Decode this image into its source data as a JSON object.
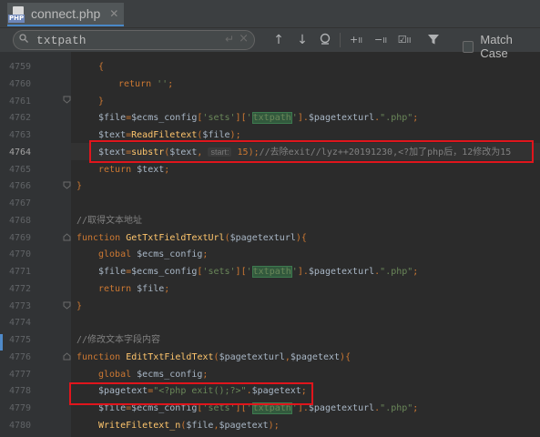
{
  "tab": {
    "title": "connect.php",
    "icon": "php-file-icon",
    "close": "✕"
  },
  "search": {
    "query": "txtpath",
    "match_case_label": "Match Case",
    "match_case_checked": false
  },
  "editor": {
    "lines": [
      {
        "n": "4759",
        "code": "{"
      },
      {
        "n": "4760",
        "code": "return '';"
      },
      {
        "n": "4761",
        "code": "}"
      },
      {
        "n": "4762",
        "code": "$file=$ecms_config['sets']['txtpath'].$pagetexturl.\".php\";"
      },
      {
        "n": "4763",
        "code": "$text=ReadFiletext($file);"
      },
      {
        "n": "4764",
        "code": "$text=substr($text, 15);//去除exit//lyz++20191230,<?加了php后，12修改为15",
        "hint": "start:"
      },
      {
        "n": "4765",
        "code": "return $text;"
      },
      {
        "n": "4766",
        "code": "}"
      },
      {
        "n": "4767",
        "code": ""
      },
      {
        "n": "4768",
        "code": "//取得文本地址"
      },
      {
        "n": "4769",
        "code": "function GetTxtFieldTextUrl($pagetexturl){"
      },
      {
        "n": "4770",
        "code": "global $ecms_config;"
      },
      {
        "n": "4771",
        "code": "$file=$ecms_config['sets']['txtpath'].$pagetexturl.\".php\";"
      },
      {
        "n": "4772",
        "code": "return $file;"
      },
      {
        "n": "4773",
        "code": "}"
      },
      {
        "n": "4774",
        "code": ""
      },
      {
        "n": "4775",
        "code": "//修改文本字段内容"
      },
      {
        "n": "4776",
        "code": "function EditTxtFieldText($pagetexturl,$pagetext){"
      },
      {
        "n": "4777",
        "code": "global $ecms_config;"
      },
      {
        "n": "4778",
        "code": "$pagetext=\"<?php exit();?>\".$pagetext;"
      },
      {
        "n": "4779",
        "code": "$file=$ecms_config['sets']['txtpath'].$pagetexturl.\".php\";"
      },
      {
        "n": "4780",
        "code": "WriteFiletext_n($file,$pagetext);"
      }
    ],
    "current_line": "4764",
    "highlight_term": "txtpath"
  },
  "colors": {
    "keyword": "#cc7832",
    "string": "#6a8759",
    "function": "#ffc66d",
    "comment": "#808080",
    "variable": "#a9b7c6",
    "annotation_box": "#e0151c"
  }
}
